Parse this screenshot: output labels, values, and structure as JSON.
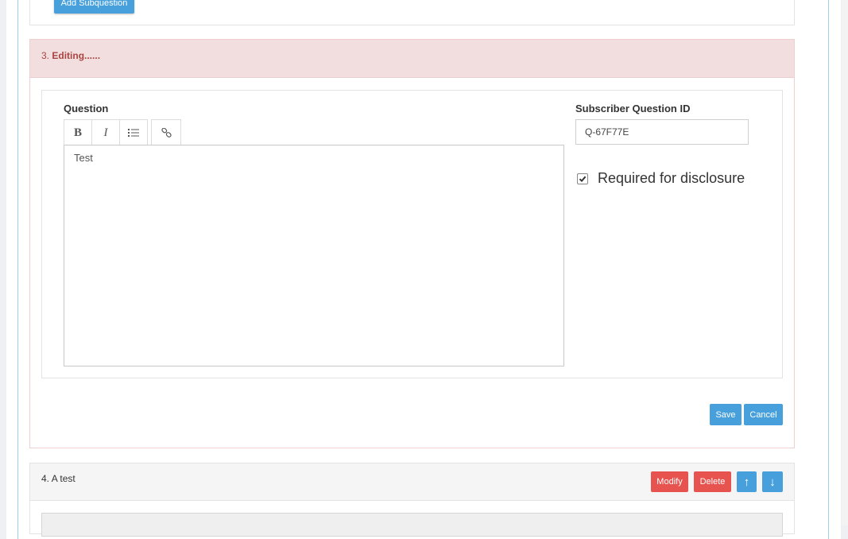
{
  "top_card": {
    "add_subquestion_label": "Add Subquestion"
  },
  "question3": {
    "number": "3.",
    "title": "Editing......",
    "question_label": "Question",
    "toolbar": {
      "bold": "B",
      "italic": "I",
      "list_icon": "list-icon",
      "link_icon": "link-icon"
    },
    "editor_value": "Test",
    "subscriber_id_label": "Subscriber Question ID",
    "subscriber_id_value": "Q-67F77E",
    "required_checked": true,
    "required_label": "Required for disclosure",
    "save_label": "Save",
    "cancel_label": "Cancel"
  },
  "question4": {
    "number": "4.",
    "title": "A test",
    "modify_label": "Modify",
    "delete_label": "Delete",
    "up_glyph": "↑",
    "down_glyph": "↓"
  },
  "colors": {
    "primary": "#47a0dc",
    "danger": "#e7534f",
    "editing_header_bg": "#f2dede",
    "editing_header_text": "#a94442"
  }
}
